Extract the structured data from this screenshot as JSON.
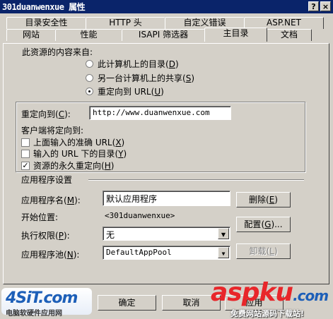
{
  "window": {
    "title": "301duanwenxue 属性",
    "help_btn": "?",
    "close_btn": "×"
  },
  "tabs_row1": [
    {
      "label": "目录安全性"
    },
    {
      "label": "HTTP 头"
    },
    {
      "label": "自定义错误"
    },
    {
      "label": "ASP.NET"
    }
  ],
  "tabs_row2": [
    {
      "label": "网站"
    },
    {
      "label": "性能"
    },
    {
      "label": "ISAPI 筛选器"
    },
    {
      "label": "主目录"
    },
    {
      "label": "文档"
    }
  ],
  "content_source": {
    "heading": "此资源的内容来自:",
    "options": [
      {
        "label": "此计算机上的目录",
        "key": "D",
        "selected": false
      },
      {
        "label": "另一台计算机上的共享",
        "key": "S",
        "selected": false
      },
      {
        "label": "重定向到 URL",
        "key": "U",
        "selected": true
      }
    ]
  },
  "redirect": {
    "label": "重定向到",
    "key": "C",
    "value": "http://www.duanwenxue.com",
    "client_heading": "客户端将定向到:",
    "checks": [
      {
        "label": "上面输入的准确 URL",
        "key": "X",
        "checked": false
      },
      {
        "label": "输入的 URL 下的目录",
        "key": "Y",
        "checked": false
      },
      {
        "label": "资源的永久重定向",
        "key": "H",
        "checked": true
      }
    ]
  },
  "app_settings": {
    "heading": "应用程序设置",
    "app_name_label": "应用程序名",
    "app_name_key": "M",
    "app_name_value": "默认应用程序",
    "delete_label": "删除",
    "delete_key": "E",
    "start_label": "开始位置:",
    "start_value": "<301duanwenxue>",
    "config_label": "配置",
    "config_key": "G",
    "perm_label": "执行权限",
    "perm_key": "P",
    "perm_value": "无",
    "pool_label": "应用程序池",
    "pool_key": "N",
    "pool_value": "DefaultAppPool",
    "unload_label": "卸载",
    "unload_key": "L"
  },
  "footer": {
    "ok": "确定",
    "cancel": "取消",
    "apply": "应用"
  },
  "watermarks": {
    "left_logo": "4SiT.com",
    "left_caption": "电脑软硬件应用网",
    "right_logo": "aspku",
    "right_suffix": ".com",
    "right_caption": "免费网站源码下载站!"
  },
  "colors": {
    "titlebar": "#0a246a",
    "face": "#d4d0c8",
    "wm_red": "#e8262a",
    "wm_blue": "#1d5fb8"
  }
}
